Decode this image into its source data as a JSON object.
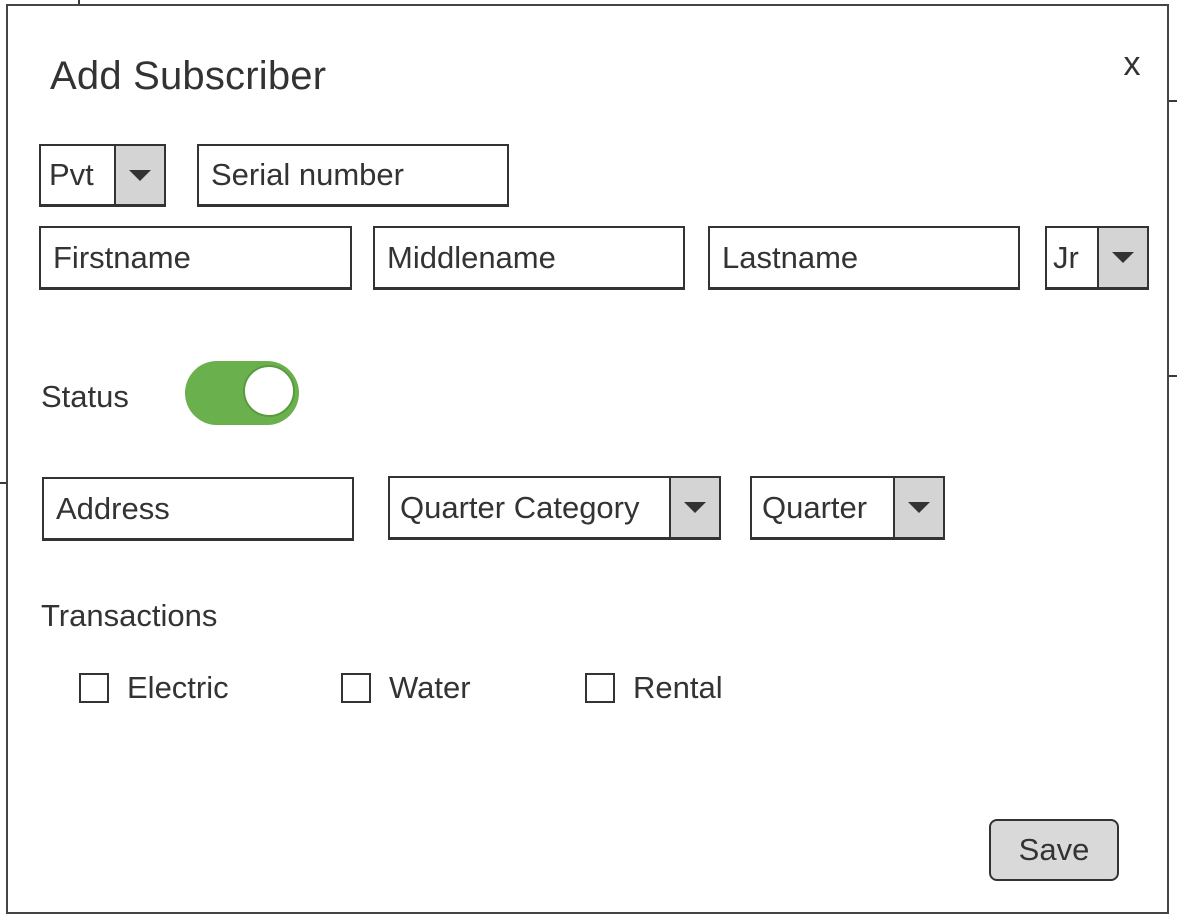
{
  "dialog": {
    "title": "Add Subscriber",
    "close_label": "x"
  },
  "row1": {
    "type_select": {
      "value": "Pvt"
    },
    "serial_number": {
      "placeholder": "Serial number"
    }
  },
  "row2": {
    "firstname": {
      "placeholder": "Firstname"
    },
    "middlename": {
      "placeholder": "Middlename"
    },
    "lastname": {
      "placeholder": "Lastname"
    },
    "suffix_select": {
      "value": "Jr"
    }
  },
  "status": {
    "label": "Status",
    "enabled": true,
    "toggle_color": "#6ab04c"
  },
  "row3": {
    "address": {
      "placeholder": "Address"
    },
    "quarter_category_select": {
      "value": "Quarter Category"
    },
    "quarter_select": {
      "value": "Quarter"
    }
  },
  "transactions": {
    "label": "Transactions",
    "options": [
      {
        "label": "Electric",
        "checked": false
      },
      {
        "label": "Water",
        "checked": false
      },
      {
        "label": "Rental",
        "checked": false
      }
    ]
  },
  "actions": {
    "save_label": "Save"
  },
  "icons": {
    "dropdown": "chevron-down-icon",
    "close": "close-icon"
  }
}
